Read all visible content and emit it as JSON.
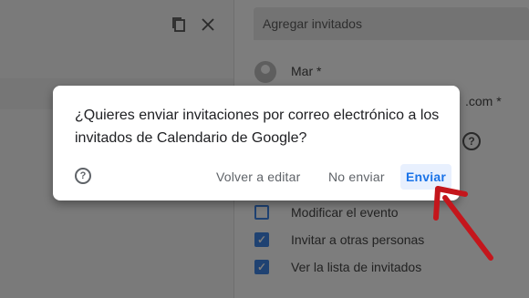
{
  "background": {
    "guest_input_placeholder": "Agregar invitados",
    "icons": {
      "copy": "copy-icon",
      "close": "close-icon",
      "help": "help-icon"
    },
    "guest_name": "Mar *",
    "guest_email_tail": ".com *",
    "permissions": [
      {
        "label": "Modificar el evento",
        "checked": false
      },
      {
        "label": "Invitar a otras personas",
        "checked": true
      },
      {
        "label": "Ver la lista de invitados",
        "checked": true
      }
    ]
  },
  "dialog": {
    "message": "¿Quieres enviar invitaciones por correo electrónico a los invitados de Calendario de Google?",
    "help_icon": "help-icon",
    "buttons": {
      "edit": "Volver a editar",
      "no_send": "No enviar",
      "send": "Enviar"
    }
  },
  "annotation": {
    "arrow_color": "#c4161c"
  },
  "colors": {
    "accent": "#1a73e8",
    "send_bg": "#e8f0fe"
  }
}
